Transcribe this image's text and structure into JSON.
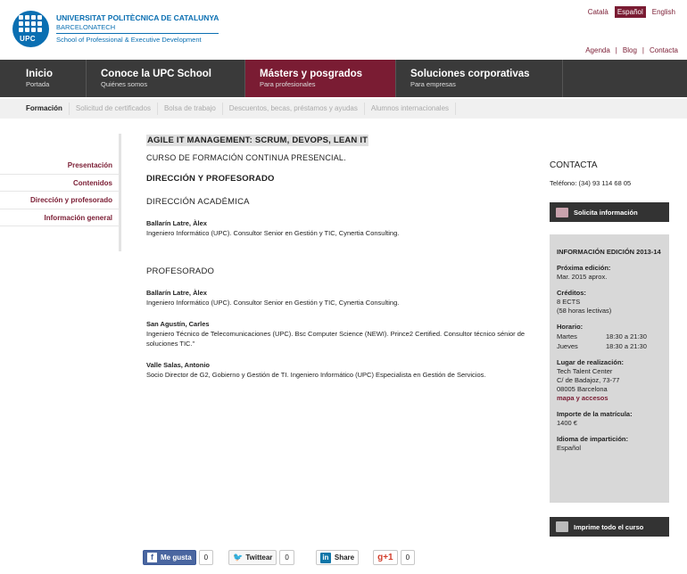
{
  "header": {
    "logo_abbr": "UPC",
    "university": "UNIVERSITAT POLITÈCNICA DE CATALUNYA",
    "campus": "BARCELONATECH",
    "school": "School of Professional & Executive Development"
  },
  "languages": [
    {
      "label": "Català",
      "active": false
    },
    {
      "label": "Español",
      "active": true
    },
    {
      "label": "English",
      "active": false
    }
  ],
  "utility_links": [
    "Agenda",
    "Blog",
    "Contacta"
  ],
  "utility_sep": "|",
  "main_nav": [
    {
      "title": "Inicio",
      "subtitle": "Portada"
    },
    {
      "title": "Conoce la UPC School",
      "subtitle": "Quiénes somos"
    },
    {
      "title": "Másters y posgrados",
      "subtitle": "Para profesionales"
    },
    {
      "title": "Soluciones corporativas",
      "subtitle": "Para empresas"
    }
  ],
  "sub_nav": [
    "Formación",
    "Solicitud de certificados",
    "Bolsa de trabajo",
    "Descuentos, becas, préstamos y ayudas",
    "Alumnos internacionales"
  ],
  "left_menu": [
    "Presentación",
    "Contenidos",
    "Dirección y profesorado",
    "Información general"
  ],
  "content": {
    "title": "AGILE IT MANAGEMENT: SCRUM, DEVOPS, LEAN IT",
    "subtitle": "CURSO DE FORMACIÓN CONTINUA PRESENCIAL.",
    "section": "DIRECCIÓN Y PROFESORADO",
    "direccion_heading": "DIRECCIÓN ACADÉMICA",
    "direccion": [
      {
        "name": "Ballarín Latre, Àlex",
        "desc": "Ingeniero Informático (UPC). Consultor Senior en Gestión y TIC, Cynertia Consulting."
      }
    ],
    "profesorado_heading": "PROFESORADO",
    "profesorado": [
      {
        "name": "Ballarín Latre, Àlex",
        "desc": "Ingeniero Informático (UPC). Consultor Senior en Gestión y TIC, Cynertia Consulting."
      },
      {
        "name": "San Agustín, Carles",
        "desc": "Ingeniero Técnico de Telecomunicaciones (UPC). Bsc Computer Science (NEWI). Prince2 Certified. Consultor técnico sénior de soluciones TIC.\""
      },
      {
        "name": "Valle Salas, Antonio",
        "desc": "Socio Director de G2, Gobierno y Gestión de TI. Ingeniero Informático (UPC) Especialista en Gestión de Servicios."
      }
    ]
  },
  "sidebar": {
    "contacta": "CONTACTA",
    "telefono": "Teléfono: (34) 93 114 68 05",
    "solicita_btn": "Solicita información",
    "info_heading": "INFORMACIÓN EDICIÓN 2013-14",
    "proxima_label": "Próxima edición:",
    "proxima_val": "Mar. 2015 aprox.",
    "creditos_label": "Créditos:",
    "creditos_val": "8 ECTS",
    "horas_val": "(58 horas lectivas)",
    "horario_label": "Horario:",
    "horario": [
      {
        "day": "Martes",
        "time": "18:30 a 21:30"
      },
      {
        "day": "Jueves",
        "time": "18:30 a 21:30"
      }
    ],
    "lugar_label": "Lugar de realización:",
    "lugar_lines": [
      "Tech Talent Center",
      "C/ de Badajoz, 73-77",
      "08005 Barcelona"
    ],
    "mapa_link": "mapa y accesos",
    "importe_label": "Importe de la matrícula:",
    "importe_val": "1400 €",
    "idioma_label": "Idioma de impartición:",
    "idioma_val": "Español",
    "imprime_btn": "Imprime todo el curso"
  },
  "social": {
    "fb_label": "Me gusta",
    "fb_count": "0",
    "tw_label": "Twittear",
    "tw_count": "0",
    "in_label": "Share",
    "g_label": "g+1",
    "g_count": "0"
  },
  "colors": {
    "brand": "#7a1c33",
    "blue": "#0a6fb2",
    "nav": "#3a3a3a"
  }
}
